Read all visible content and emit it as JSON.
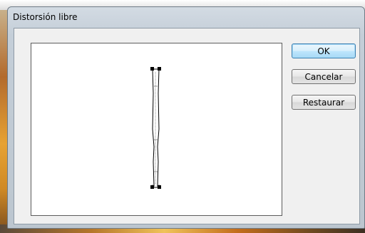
{
  "window": {
    "title": "Distorsión libre"
  },
  "buttons": {
    "ok_label": "OK",
    "cancel_label": "Cancelar",
    "reset_label": "Restaurar"
  },
  "colors": {
    "titlebar": "#c4ced8",
    "default_button": "#bee6fd",
    "preview_background": "#ffffff"
  }
}
